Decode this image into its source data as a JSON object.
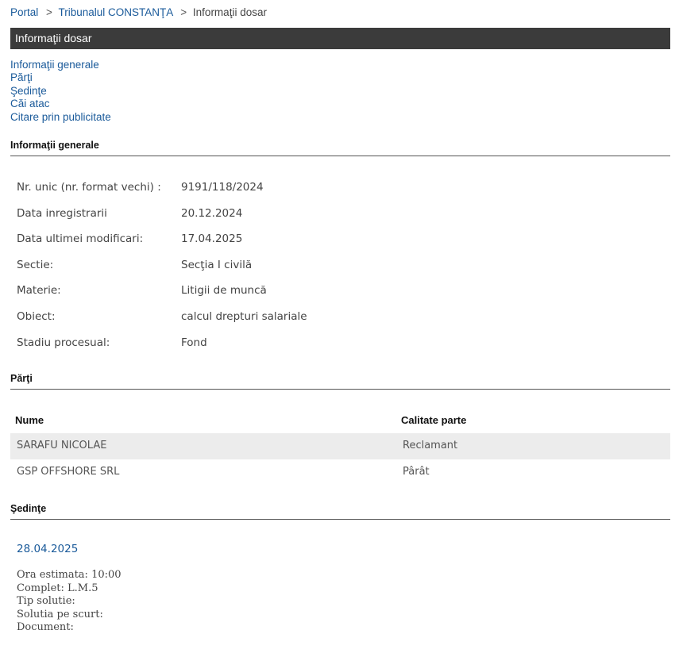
{
  "breadcrumb": {
    "items": [
      "Portal",
      "Tribunalul CONSTANŢA"
    ],
    "current": "Informaţii dosar",
    "separator": ">"
  },
  "title": "Informaţii dosar",
  "anchors": [
    "Informaţii generale",
    "Părţi",
    "Şedinţe",
    "Căi atac",
    "Citare prin publicitate"
  ],
  "general": {
    "heading": "Informaţii generale",
    "rows": [
      {
        "label": "Nr. unic (nr. format vechi) :",
        "value": "9191/118/2024"
      },
      {
        "label": "Data inregistrarii",
        "value": "20.12.2024"
      },
      {
        "label": "Data ultimei modificari:",
        "value": "17.04.2025"
      },
      {
        "label": "Sectie:",
        "value": "Secţia I civilă"
      },
      {
        "label": "Materie:",
        "value": "Litigii de muncă"
      },
      {
        "label": "Obiect:",
        "value": "calcul drepturi salariale"
      },
      {
        "label": "Stadiu procesual:",
        "value": "Fond"
      }
    ]
  },
  "parti": {
    "heading": "Părţi",
    "columns": [
      "Nume",
      "Calitate parte"
    ],
    "rows": [
      [
        "SARAFU NICOLAE",
        "Reclamant"
      ],
      [
        "GSP OFFSHORE SRL",
        "Pârât"
      ]
    ]
  },
  "sedinte": {
    "heading": "Şedinţe",
    "date": "28.04.2025",
    "details": [
      "Ora estimata: 10:00",
      "Complet: L.M.5",
      "Tip solutie:",
      "Solutia pe scurt:",
      "Document:"
    ]
  }
}
